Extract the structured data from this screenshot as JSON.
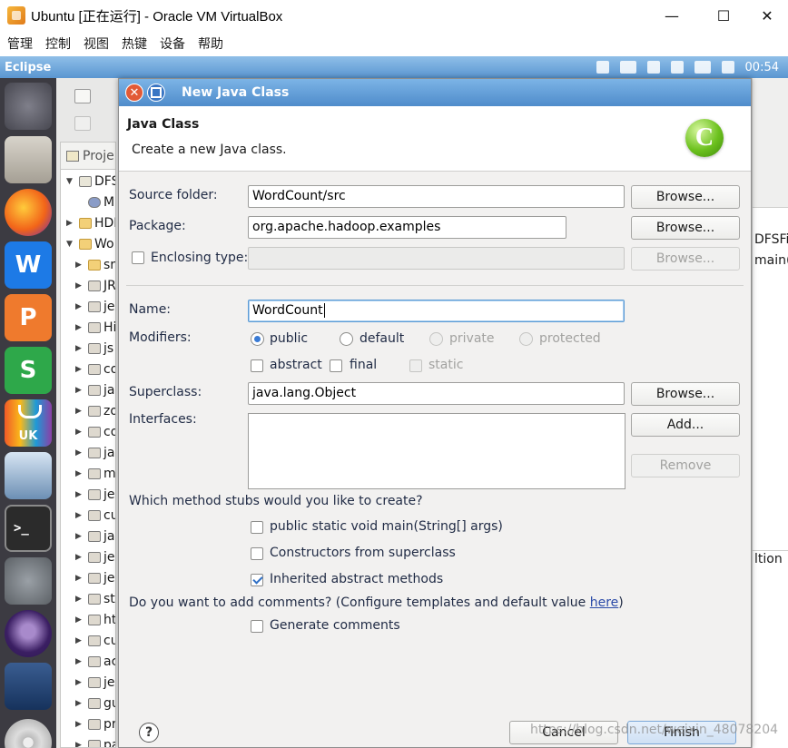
{
  "host_window": {
    "title": "Ubuntu [正在运行] - Oracle VM VirtualBox",
    "minimize": "—",
    "maximize": "☐",
    "close": "✕",
    "menu": [
      "管理",
      "控制",
      "视图",
      "热键",
      "设备",
      "帮助"
    ]
  },
  "ubuntu_panel": {
    "app_title": "Eclipse",
    "clock": "00:54",
    "indicator_icons": [
      "download-icon",
      "keyboard-icon",
      "calendar-icon",
      "network-icon",
      "battery-icon",
      "volume-icon"
    ]
  },
  "launcher": {
    "items": [
      "ubuntu-icon",
      "files-icon",
      "firefox-icon",
      "writer-icon",
      "presentation-icon",
      "spreadsheet-icon",
      "ukstore-icon",
      "updater-icon",
      "terminal-icon",
      "settings-icon",
      "eclipse-icon",
      "text-editor-icon",
      "disk-icon"
    ],
    "writer_glyph": "W",
    "presentation_glyph": "P",
    "spreadsheet_glyph": "S",
    "ukstore_text": "UK",
    "terminal_glyph": ">_"
  },
  "project_explorer": {
    "tab_label": "Proje",
    "rows": [
      {
        "arrow": "▼",
        "label": "DFS",
        "icon": "project"
      },
      {
        "arrow": "",
        "label": "M",
        "icon": "elephant"
      },
      {
        "arrow": "▶",
        "label": "HDF",
        "icon": "folder"
      },
      {
        "arrow": "▼",
        "label": "Wo",
        "icon": "folder"
      },
      {
        "arrow": "▶",
        "label": "sr",
        "icon": "folder"
      },
      {
        "arrow": "▶",
        "label": "JR",
        "icon": "jar"
      },
      {
        "arrow": "▶",
        "label": "je",
        "icon": "jar"
      },
      {
        "arrow": "▶",
        "label": "Hi",
        "icon": "jar"
      },
      {
        "arrow": "▶",
        "label": "js",
        "icon": "jar"
      },
      {
        "arrow": "▶",
        "label": "co",
        "icon": "jar"
      },
      {
        "arrow": "▶",
        "label": "ja",
        "icon": "jar"
      },
      {
        "arrow": "▶",
        "label": "zo",
        "icon": "jar"
      },
      {
        "arrow": "▶",
        "label": "co",
        "icon": "jar"
      },
      {
        "arrow": "▶",
        "label": "ja",
        "icon": "jar"
      },
      {
        "arrow": "▶",
        "label": "m",
        "icon": "jar"
      },
      {
        "arrow": "▶",
        "label": "je",
        "icon": "jar"
      },
      {
        "arrow": "▶",
        "label": "cu",
        "icon": "jar"
      },
      {
        "arrow": "▶",
        "label": "ja",
        "icon": "jar"
      },
      {
        "arrow": "▶",
        "label": "je",
        "icon": "jar"
      },
      {
        "arrow": "▶",
        "label": "je",
        "icon": "jar"
      },
      {
        "arrow": "▶",
        "label": "st",
        "icon": "jar"
      },
      {
        "arrow": "▶",
        "label": "ht",
        "icon": "jar"
      },
      {
        "arrow": "▶",
        "label": "cu",
        "icon": "jar"
      },
      {
        "arrow": "▶",
        "label": "ac",
        "icon": "jar"
      },
      {
        "arrow": "▶",
        "label": "je",
        "icon": "jar"
      },
      {
        "arrow": "▶",
        "label": "gu",
        "icon": "jar"
      },
      {
        "arrow": "▶",
        "label": "pr",
        "icon": "jar"
      },
      {
        "arrow": "▶",
        "label": "pa",
        "icon": "jar"
      }
    ]
  },
  "right_peek": {
    "dfs_label": "DFSFil",
    "main_label": "main(",
    "console_label": "ltion"
  },
  "dialog": {
    "title": "New Java Class",
    "close_glyph": "✕",
    "header": {
      "heading": "Java Class",
      "description": "Create a new Java class.",
      "icon_glyph": "C"
    },
    "source_folder": {
      "label": "Source folder:",
      "value": "WordCount/src",
      "browse": "Browse..."
    },
    "package": {
      "label": "Package:",
      "value": "org.apache.hadoop.examples",
      "browse": "Browse..."
    },
    "enclosing_type": {
      "label": "Enclosing type:",
      "value": "",
      "browse": "Browse...",
      "checked": false
    },
    "name": {
      "label": "Name:",
      "value": "WordCount"
    },
    "modifiers": {
      "label": "Modifiers:",
      "access": [
        {
          "label": "public",
          "selected": true,
          "enabled": true
        },
        {
          "label": "default",
          "selected": false,
          "enabled": true
        },
        {
          "label": "private",
          "selected": false,
          "enabled": false
        },
        {
          "label": "protected",
          "selected": false,
          "enabled": false
        }
      ],
      "flags": [
        {
          "label": "abstract",
          "checked": false,
          "enabled": true
        },
        {
          "label": "final",
          "checked": false,
          "enabled": true
        },
        {
          "label": "static",
          "checked": false,
          "enabled": false
        }
      ]
    },
    "superclass": {
      "label": "Superclass:",
      "value": "java.lang.Object",
      "browse": "Browse..."
    },
    "interfaces": {
      "label": "Interfaces:",
      "add": "Add...",
      "remove": "Remove"
    },
    "stubs": {
      "question": "Which method stubs would you like to create?",
      "options": [
        {
          "label": "public static void main(String[] args)",
          "checked": false
        },
        {
          "label": "Constructors from superclass",
          "checked": false
        },
        {
          "label": "Inherited abstract methods",
          "checked": true
        }
      ]
    },
    "comments": {
      "question_prefix": "Do you want to add comments? (Configure templates and default value ",
      "link": "here",
      "question_suffix": ")",
      "option": {
        "label": "Generate comments",
        "checked": false
      }
    },
    "footer": {
      "help_glyph": "?",
      "cancel": "Cancel",
      "finish": "Finish"
    }
  },
  "watermark": "https://blog.csdn.net/weixin_48078204"
}
